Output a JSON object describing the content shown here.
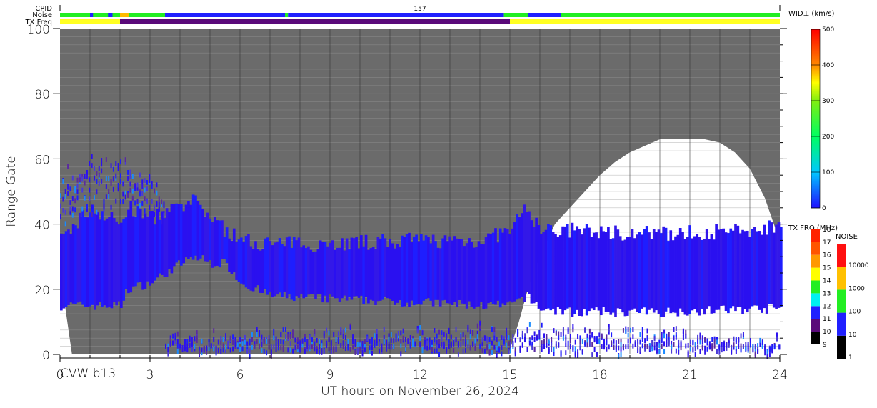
{
  "chart_data": {
    "type": "heatmap",
    "title": "",
    "xlabel": "UT hours on November 26, 2024",
    "ylabel": "Range Gate",
    "station_label": "CVW b13",
    "xlim": [
      0,
      24
    ],
    "ylim": [
      0,
      100
    ],
    "xticks": [
      "0",
      "3",
      "6",
      "9",
      "12",
      "15",
      "18",
      "21",
      "24"
    ],
    "yticks": [
      "0",
      "20",
      "40",
      "60",
      "80",
      "100"
    ],
    "header": {
      "cpid_label": "CPID",
      "cpid_value": "157",
      "noise_label": "Noise",
      "txfreq_label": "TX Freq",
      "noise_segments": [
        {
          "from": 0,
          "to": 2,
          "color": "#22ee22"
        },
        {
          "from": 1.0,
          "to": 1.1,
          "color": "#2020ff"
        },
        {
          "from": 1.6,
          "to": 1.75,
          "color": "#2020ff"
        },
        {
          "from": 2,
          "to": 2.3,
          "color": "#ffbb00"
        },
        {
          "from": 2.3,
          "to": 3.5,
          "color": "#22ee22"
        },
        {
          "from": 3.5,
          "to": 7.5,
          "color": "#2020ff"
        },
        {
          "from": 7.5,
          "to": 7.6,
          "color": "#22ee22"
        },
        {
          "from": 7.6,
          "to": 14.8,
          "color": "#2020ff"
        },
        {
          "from": 14.8,
          "to": 15.6,
          "color": "#22ee22"
        },
        {
          "from": 15.6,
          "to": 16.7,
          "color": "#2020ff"
        },
        {
          "from": 16.7,
          "to": 24,
          "color": "#22ee22"
        }
      ],
      "txfreq_segments": [
        {
          "from": 0,
          "to": 2,
          "color": "#ffff22"
        },
        {
          "from": 2,
          "to": 15,
          "color": "#5a0a7a"
        },
        {
          "from": 15,
          "to": 24,
          "color": "#ffff22"
        }
      ]
    },
    "no_data_regions": [
      [
        [
          0,
          0
        ],
        [
          0.4,
          0
        ],
        [
          0.15,
          16
        ],
        [
          0,
          16
        ]
      ],
      [
        [
          14.95,
          0
        ],
        [
          15.3,
          10
        ],
        [
          15.6,
          20
        ],
        [
          16,
          30
        ],
        [
          16.5,
          40
        ],
        [
          17,
          45
        ],
        [
          17.5,
          50
        ],
        [
          18,
          55
        ],
        [
          18.5,
          59
        ],
        [
          19,
          62
        ],
        [
          19.5,
          64
        ],
        [
          20,
          66
        ],
        [
          21.5,
          66
        ],
        [
          22,
          65
        ],
        [
          22.5,
          62
        ],
        [
          23,
          57
        ],
        [
          23.5,
          48
        ],
        [
          23.8,
          40
        ],
        [
          24,
          35
        ],
        [
          24,
          0
        ]
      ]
    ],
    "echo_bands": [
      {
        "name": "f-region",
        "from": 0,
        "to": 24,
        "profile": [
          [
            0,
            15,
            35
          ],
          [
            1,
            15,
            45
          ],
          [
            2,
            15,
            40
          ],
          [
            2.2,
            20,
            45
          ],
          [
            3,
            22,
            42
          ],
          [
            4,
            28,
            45
          ],
          [
            4.5,
            30,
            47
          ],
          [
            5,
            28,
            42
          ],
          [
            5.5,
            28,
            38
          ],
          [
            6,
            22,
            35
          ],
          [
            7,
            18,
            34
          ],
          [
            9,
            17,
            34
          ],
          [
            12,
            16,
            35
          ],
          [
            14,
            15,
            35
          ],
          [
            15,
            15,
            38
          ],
          [
            15.5,
            18,
            45
          ],
          [
            16,
            14,
            38
          ],
          [
            17,
            13,
            38
          ],
          [
            20,
            13,
            37
          ],
          [
            23,
            14,
            38
          ],
          [
            24,
            14,
            40
          ]
        ]
      },
      {
        "name": "upper-scatter",
        "from": 0,
        "to": 3.5,
        "profile": [
          [
            0,
            40,
            55
          ],
          [
            1,
            42,
            58
          ],
          [
            2,
            45,
            60
          ],
          [
            3,
            42,
            52
          ],
          [
            3.5,
            40,
            45
          ]
        ]
      },
      {
        "name": "ground-scatter",
        "from": 3.5,
        "to": 15,
        "profile": [
          [
            3.5,
            0,
            3
          ],
          [
            6,
            0,
            5
          ],
          [
            9,
            0,
            6
          ],
          [
            12,
            0,
            6
          ],
          [
            15,
            0,
            7
          ]
        ]
      },
      {
        "name": "near-range-sparse",
        "from": 15,
        "to": 24,
        "profile": [
          [
            15,
            0,
            8
          ],
          [
            18,
            0,
            6
          ],
          [
            24,
            0,
            4
          ]
        ]
      }
    ],
    "velocity_width_scale": {
      "label": "WID⊥ (km/s)",
      "ticks": [
        "0",
        "100",
        "200",
        "300",
        "400",
        "500"
      ],
      "range": [
        0,
        500
      ]
    },
    "txfreq_scale": {
      "label": "TX FRQ (MHz)",
      "ticks": [
        "9",
        "10",
        "11",
        "12",
        "13",
        "14",
        "15",
        "16",
        "17",
        "18"
      ],
      "colors": [
        "#000000",
        "#5a0a7a",
        "#2020ff",
        "#00f0f0",
        "#22ee22",
        "#ffff00",
        "#ff9900",
        "#ff5500",
        "#ff2200"
      ]
    },
    "noise_scale": {
      "label": "NOISE",
      "ticks": [
        "1",
        "10",
        "100",
        "1000",
        "10000"
      ],
      "colors": [
        "#000000",
        "#2020ff",
        "#22ee22",
        "#ffc000",
        "#ff1010"
      ]
    },
    "colors": {
      "background": "#6b6b6b",
      "echo": "#2a10f0",
      "no_data": "#ffffff"
    }
  }
}
